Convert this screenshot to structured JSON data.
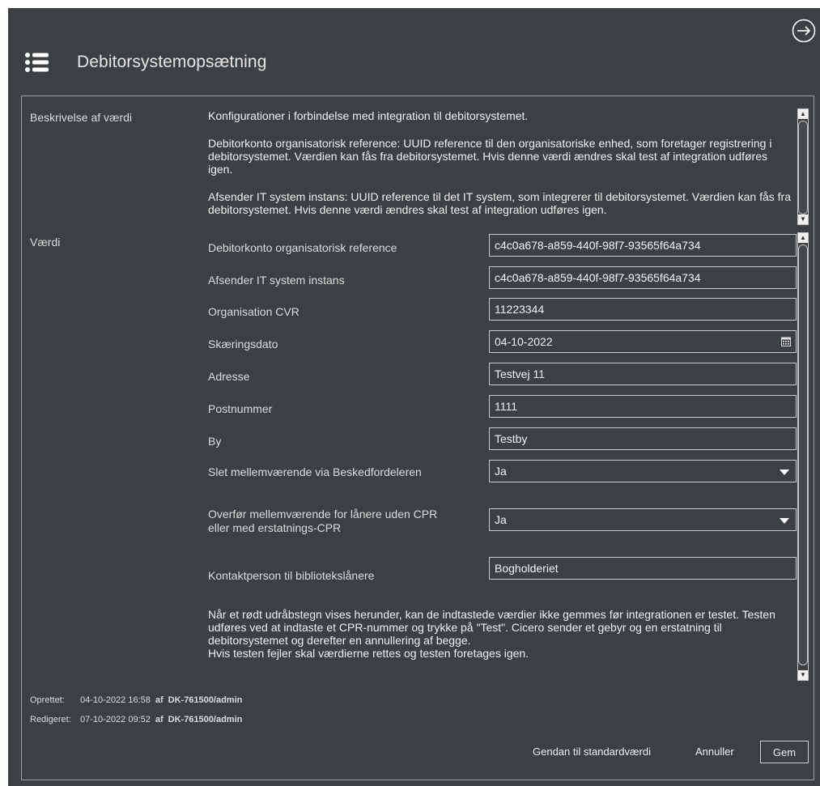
{
  "header": {
    "title": "Debitorsystemopsætning"
  },
  "sections": {
    "description_label": "Beskrivelse af værdi",
    "value_label": "Værdi"
  },
  "description": {
    "paragraphs": [
      "Konfigurationer i forbindelse med integration til debitorsystemet.",
      "Debitorkonto organisatorisk reference: UUID reference til den organisatoriske enhed, som foretager registrering i debitorsystemet. Værdien kan fås fra debitorsystemet. Hvis denne værdi ændres skal test af integration udføres igen.",
      "Afsender IT system instans: UUID reference til det IT system, som integrerer til debitorsystemet. Værdien kan fås fra debitorsystemet. Hvis denne værdi ændres skal test af integration udføres igen."
    ]
  },
  "fields": [
    {
      "label": "Debitorkonto organisatorisk reference",
      "value": "c4c0a678-a859-440f-98f7-93565f64a734"
    },
    {
      "label": "Afsender IT system instans",
      "value": "c4c0a678-a859-440f-98f7-93565f64a734"
    },
    {
      "label": "Organisation CVR",
      "value": "11223344"
    },
    {
      "label": "Skæringsdato",
      "value": "04-10-2022"
    },
    {
      "label": "Adresse",
      "value": "Testvej 11"
    },
    {
      "label": "Postnummer",
      "value": "1111"
    },
    {
      "label": "By",
      "value": "Testby"
    },
    {
      "label": "Slet mellemværende via Beskedfordeleren",
      "value": "Ja"
    },
    {
      "label_line1": "Overfør mellemværende for lånere uden CPR",
      "label_line2": "eller med erstatnings-CPR",
      "value": "Ja"
    },
    {
      "label": "Kontaktperson til bibliotekslånere",
      "value": "Bogholderiet"
    }
  ],
  "note": {
    "line1": "Når et rødt udråbstegn vises herunder, kan de indtastede værdier ikke gemmes før integrationen er testet. Testen udføres ved at indtaste et CPR-nummer og trykke på \"Test\". Cicero sender et gebyr og en erstatning til debitorsystemet og derefter en annullering af begge.",
    "line2": "Hvis testen fejler skal værdierne rettes og testen foretages igen."
  },
  "meta": {
    "created_label": "Oprettet:",
    "created_date": "04-10-2022 16:58",
    "created_by_word": "af",
    "created_by": "DK-761500/admin",
    "edited_label": "Redigeret:",
    "edited_date": "07-10-2022 09:52",
    "edited_by_word": "af",
    "edited_by": "DK-761500/admin"
  },
  "footer": {
    "reset_label": "Gendan til standardværdi",
    "cancel_label": "Annuller",
    "save_label": "Gem"
  },
  "icons": {
    "menu": "list-icon",
    "exit": "arrow-right-circle-icon",
    "calendar": "calendar-icon",
    "dropdown": "caret-down-icon"
  }
}
